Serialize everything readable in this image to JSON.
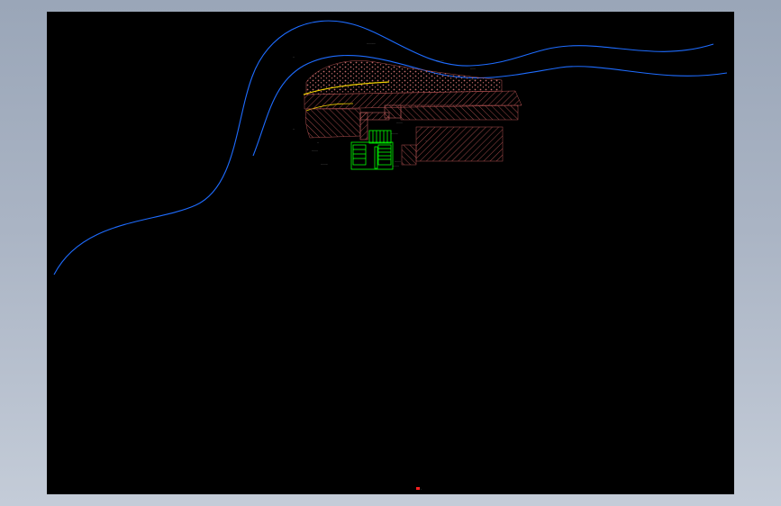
{
  "viewport": {
    "background_color": "#9aa6b8",
    "canvas_color": "#000000"
  },
  "drawing": {
    "river_color": "#1e6cff",
    "hatch_color": "#b05050",
    "structure_color": "#00ff00",
    "annotation_color": "#ffffff",
    "path_color": "#f0d000",
    "annotations": {
      "label_a": "··········",
      "label_b": "·········",
      "label_c": "······",
      "label_d": "·······",
      "label_e": "········",
      "label_f": "·······",
      "label_g": "········",
      "label_h": "·······",
      "label_i": "·······",
      "label_j": "·······",
      "marker_1": "··",
      "marker_2": "··",
      "marker_3": "··",
      "marker_4": "··"
    },
    "sheet_marker": "·"
  }
}
